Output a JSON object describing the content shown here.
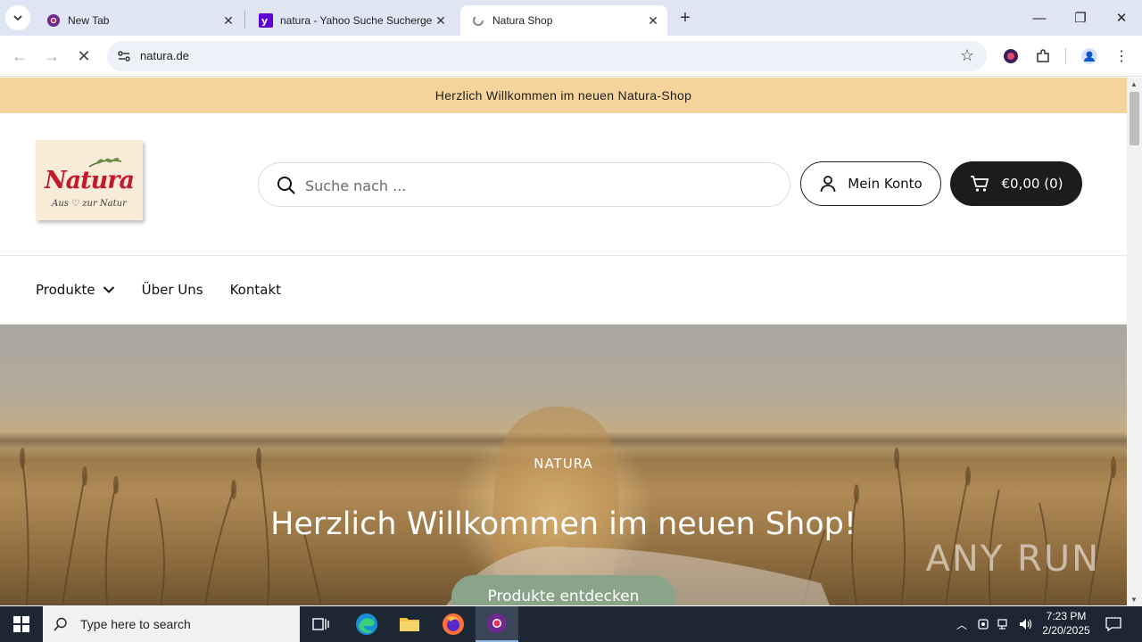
{
  "browser": {
    "tabs": [
      {
        "title": "New Tab",
        "favicon": "chrome-icon",
        "active": false
      },
      {
        "title": "natura - Yahoo Suche Suchergebnisse",
        "favicon": "yahoo-icon",
        "active": false
      },
      {
        "title": "Natura Shop",
        "favicon": "loading-icon",
        "active": true
      }
    ],
    "url": "natura.de"
  },
  "site": {
    "announcement": "Herzlich Willkommen im neuen Natura-Shop",
    "logo": {
      "wordmark": "Natura",
      "tagline": "Aus ♡ zur Natur"
    },
    "search_placeholder": "Suche nach ...",
    "account_label": "Mein Konto",
    "cart_label": "€0,00 (0)",
    "nav": [
      {
        "label": "Produkte",
        "has_dropdown": true
      },
      {
        "label": "Über Uns",
        "has_dropdown": false
      },
      {
        "label": "Kontakt",
        "has_dropdown": false
      }
    ],
    "hero": {
      "eyebrow": "NATURA",
      "title": "Herzlich Willkommen im neuen Shop!",
      "cta": "Produkte entdecken"
    },
    "watermark": "ANY RUN"
  },
  "taskbar": {
    "search_placeholder": "Type here to search",
    "time": "7:23 PM",
    "date": "2/20/2025"
  },
  "colors": {
    "announcement_bg": "#f5d49c",
    "brand_red": "#c4182c",
    "cart_bg": "#1c1c1c",
    "cta_bg": "#8aa48a"
  }
}
